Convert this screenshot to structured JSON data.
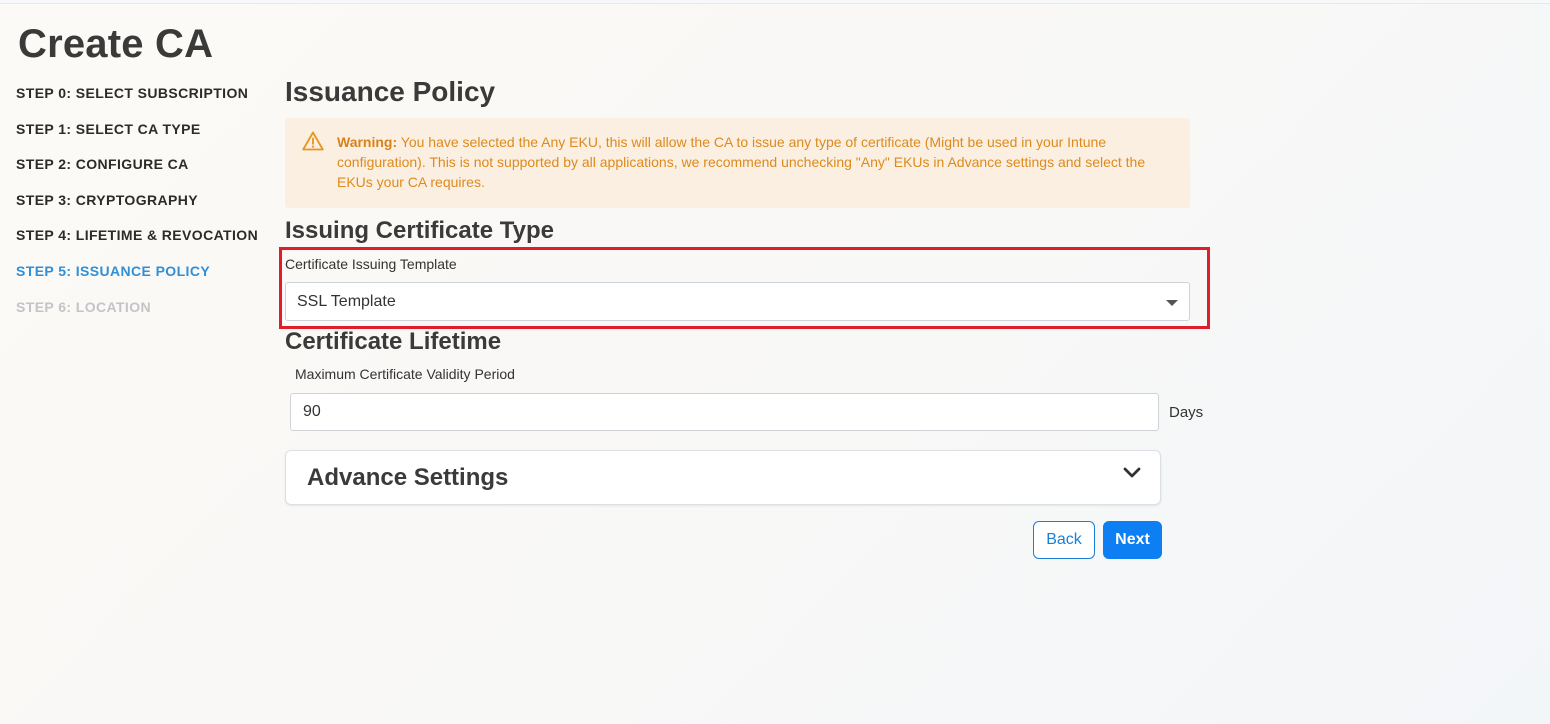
{
  "page": {
    "title": "Create CA"
  },
  "steps": [
    {
      "label": "STEP 0: SELECT SUBSCRIPTION",
      "state": "done"
    },
    {
      "label": "STEP 1: SELECT CA TYPE",
      "state": "done"
    },
    {
      "label": "STEP 2: CONFIGURE CA",
      "state": "done"
    },
    {
      "label": "STEP 3: CRYPTOGRAPHY",
      "state": "done"
    },
    {
      "label": "STEP 4: LIFETIME & REVOCATION",
      "state": "done"
    },
    {
      "label": "STEP 5: ISSUANCE POLICY",
      "state": "active"
    },
    {
      "label": "STEP 6: LOCATION",
      "state": "disabled"
    }
  ],
  "main": {
    "section_title": "Issuance Policy",
    "warning": {
      "icon": "warning-triangle-icon",
      "prefix": "Warning:",
      "text": " You have selected the Any EKU, this will allow the CA to issue any type of certificate (Might be used in your Intune configuration). This is not supported by all applications, we recommend unchecking \"Any\" EKUs in Advance settings and select the EKUs your CA requires."
    },
    "issuing_type": {
      "title": "Issuing Certificate Type",
      "template_label": "Certificate Issuing Template",
      "template_value": "SSL Template"
    },
    "lifetime": {
      "title": "Certificate Lifetime",
      "validity_label": "Maximum Certificate Validity Period",
      "validity_value": "90",
      "unit": "Days"
    },
    "advance": {
      "title": "Advance Settings",
      "icon": "chevron-down-icon"
    },
    "buttons": {
      "back": "Back",
      "next": "Next"
    }
  },
  "colors": {
    "active_step": "#2f8fd8",
    "disabled_step": "#c2c4c7",
    "warning_bg": "#fbefe1",
    "warning_text": "#de8a1c",
    "highlight": "#e01e2b",
    "primary": "#0d7ff2"
  }
}
